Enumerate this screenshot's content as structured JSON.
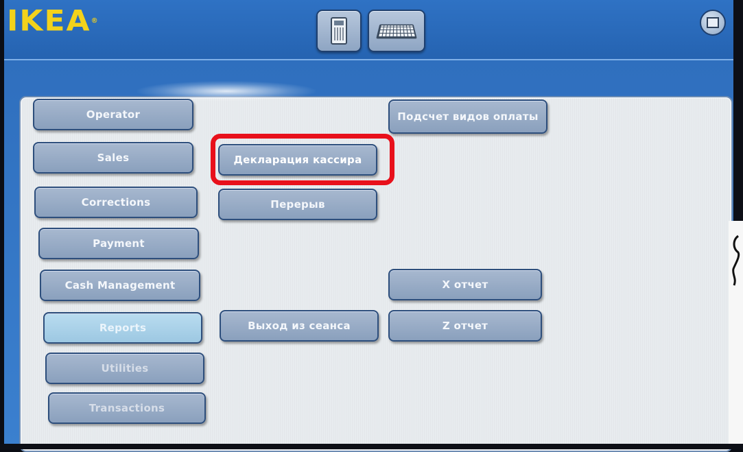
{
  "header": {
    "logo_text": "IKEA",
    "buttons": [
      {
        "name": "calculator",
        "icon": "calculator-icon"
      },
      {
        "name": "keyboard",
        "icon": "keyboard-icon"
      }
    ],
    "corner_icon": "display-icon"
  },
  "menu": {
    "left_buttons": [
      {
        "label": "Operator",
        "state": "normal"
      },
      {
        "label": "Sales",
        "state": "normal"
      },
      {
        "label": "Corrections",
        "state": "normal"
      },
      {
        "label": "Payment",
        "state": "normal"
      },
      {
        "label": "Cash Management",
        "state": "normal"
      },
      {
        "label": "Reports",
        "state": "active"
      },
      {
        "label": "Utilities",
        "state": "normal"
      },
      {
        "label": "Transactions",
        "state": "normal"
      }
    ],
    "middle_buttons": [
      {
        "label": "Декларация кассира"
      },
      {
        "label": "Перерыв"
      },
      {
        "label": "Выход из сеанса"
      }
    ],
    "right_buttons": [
      {
        "label": "Подсчет видов оплаты"
      },
      {
        "label": "X отчет"
      },
      {
        "label": "Z отчет"
      }
    ]
  },
  "colors": {
    "logo": "#f3d21b",
    "highlight": "#e8101b",
    "background": "#2a67b8",
    "panel": "#e8ecef"
  }
}
